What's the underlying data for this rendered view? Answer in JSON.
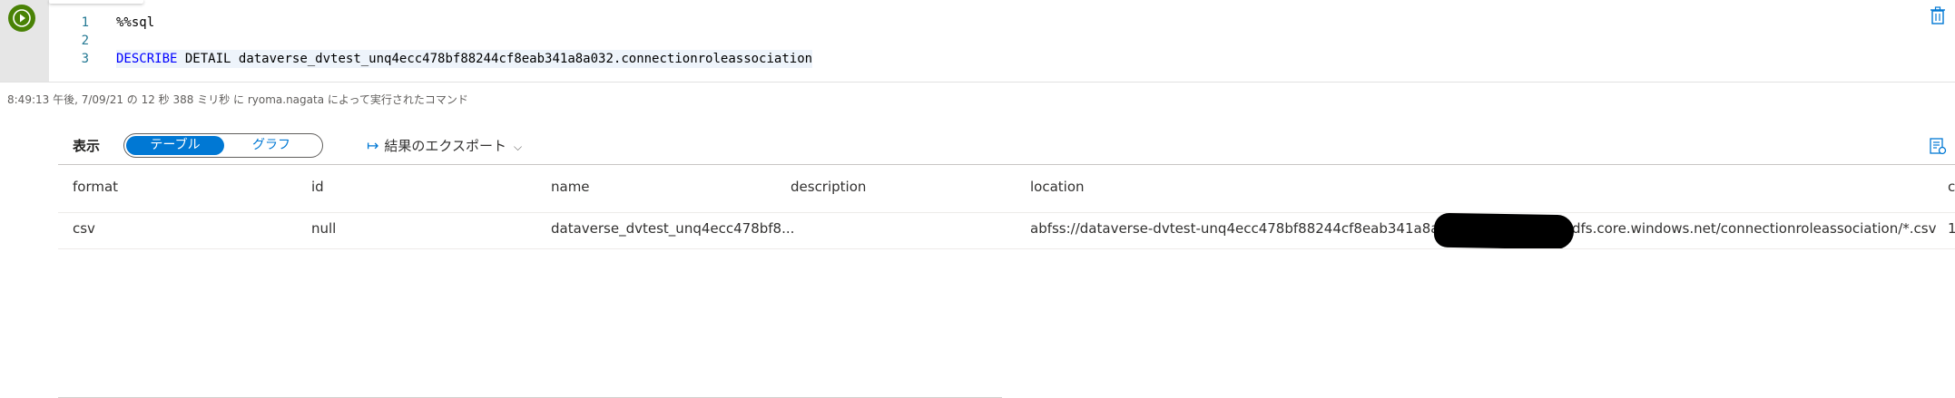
{
  "code_cell": {
    "lines": [
      {
        "num": "1",
        "text": "%%sql"
      },
      {
        "num": "2",
        "text": ""
      },
      {
        "num": "3",
        "kw1": "DESCRIBE",
        "kw2": "DETAIL",
        "ident": "dataverse_dvtest_unq4ecc478bf88244cf8eab341a8a032",
        "dot": ".",
        "table": "connectionroleassociation"
      }
    ]
  },
  "status": "8:49:13 午後, 7/09/21 の 12 秒 388 ミリ秒 に ryoma.nagata によって実行されたコマンド",
  "toolbar": {
    "view_label": "表示",
    "toggle_table": "テーブル",
    "toggle_graph": "グラフ",
    "export_label": "結果のエクスポート"
  },
  "table": {
    "columns": [
      "format",
      "id",
      "name",
      "description",
      "location",
      "c"
    ],
    "rows": [
      {
        "format": "csv",
        "id": "null",
        "name": "dataverse_dvtest_unq4ecc478bf8...",
        "description": "",
        "location_start": "abfss://dataverse-dvtest-unq4ecc478bf88244cf8eab341a8a032@",
        "location_end": "dfs.core.windows.net/connectionroleassociation/*.csv",
        "cut": "1"
      }
    ]
  },
  "colors": {
    "accent": "#0078d4",
    "run_button": "#498205"
  }
}
